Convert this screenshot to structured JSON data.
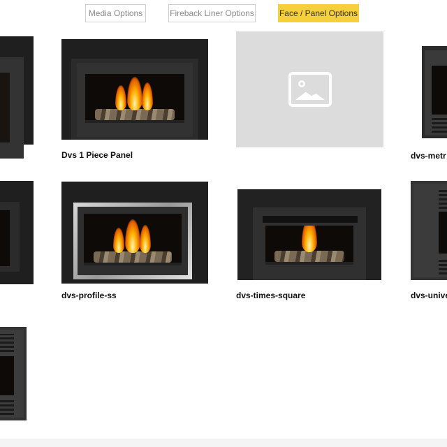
{
  "tabs": [
    {
      "label": "Media Options",
      "active": false
    },
    {
      "label": "Fireback Liner Options",
      "active": false
    },
    {
      "label": "Face / Panel Options",
      "active": true
    }
  ],
  "products": [
    {
      "label": ""
    },
    {
      "label": "Dvs 1 Piece Panel"
    },
    {
      "label": ""
    },
    {
      "label": "dvs-metr"
    },
    {
      "label": ""
    },
    {
      "label": "dvs-profile-ss"
    },
    {
      "label": "dvs-times-square"
    },
    {
      "label": "dvs-unive"
    },
    {
      "label": ""
    }
  ],
  "colors": {
    "active_tab": "#f5cf3c",
    "placeholder": "#dcdcdc"
  },
  "icons": {
    "placeholder": "image-placeholder-icon"
  }
}
